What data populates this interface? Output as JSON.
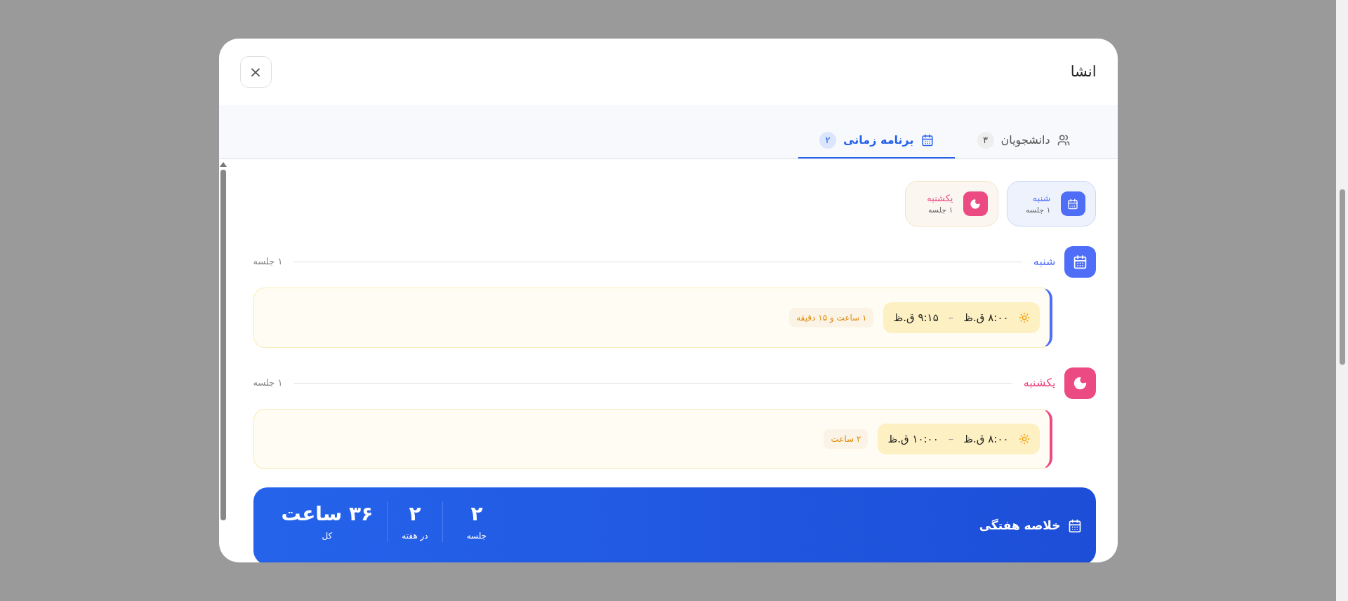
{
  "dialog": {
    "title": "انشا",
    "close": "×"
  },
  "tabs": [
    {
      "label": "دانشجویان",
      "count": "۳",
      "kind": "users",
      "selected": false
    },
    {
      "label": "برنامه زمانی",
      "count": "۲",
      "kind": "calendar",
      "selected": true
    }
  ],
  "day_chips": [
    {
      "day": "شنبه",
      "sessions": "۱ جلسه",
      "kind": "calendar",
      "color": "#4f6ef7"
    },
    {
      "day": "یکشنبه",
      "sessions": "۱ جلسه",
      "kind": "moon",
      "color": "#ec4a82"
    }
  ],
  "days": [
    {
      "day": "شنبه",
      "kind": "calendar",
      "color": "#4f6ef7",
      "count": "۱ جلسه",
      "sessions": [
        {
          "start": "۸:۰۰ ق.ظ",
          "separator": "–",
          "end": "۹:۱۵ ق.ظ",
          "duration": "۱ ساعت و ۱۵ دقیقه"
        }
      ]
    },
    {
      "day": "یکشنبه",
      "kind": "moon",
      "color": "#ec4a82",
      "count": "۱ جلسه",
      "sessions": [
        {
          "start": "۸:۰۰ ق.ظ",
          "separator": "–",
          "end": "۱۰:۰۰ ق.ظ",
          "duration": "۲ ساعت"
        }
      ]
    }
  ],
  "summary": {
    "title": "خلاصه هفتگی",
    "stats": [
      {
        "value": "۲",
        "label": "جلسه"
      },
      {
        "value": "۲",
        "label": "در هفته"
      },
      {
        "value": "۳۶ ساعت",
        "label": "کل"
      }
    ]
  }
}
